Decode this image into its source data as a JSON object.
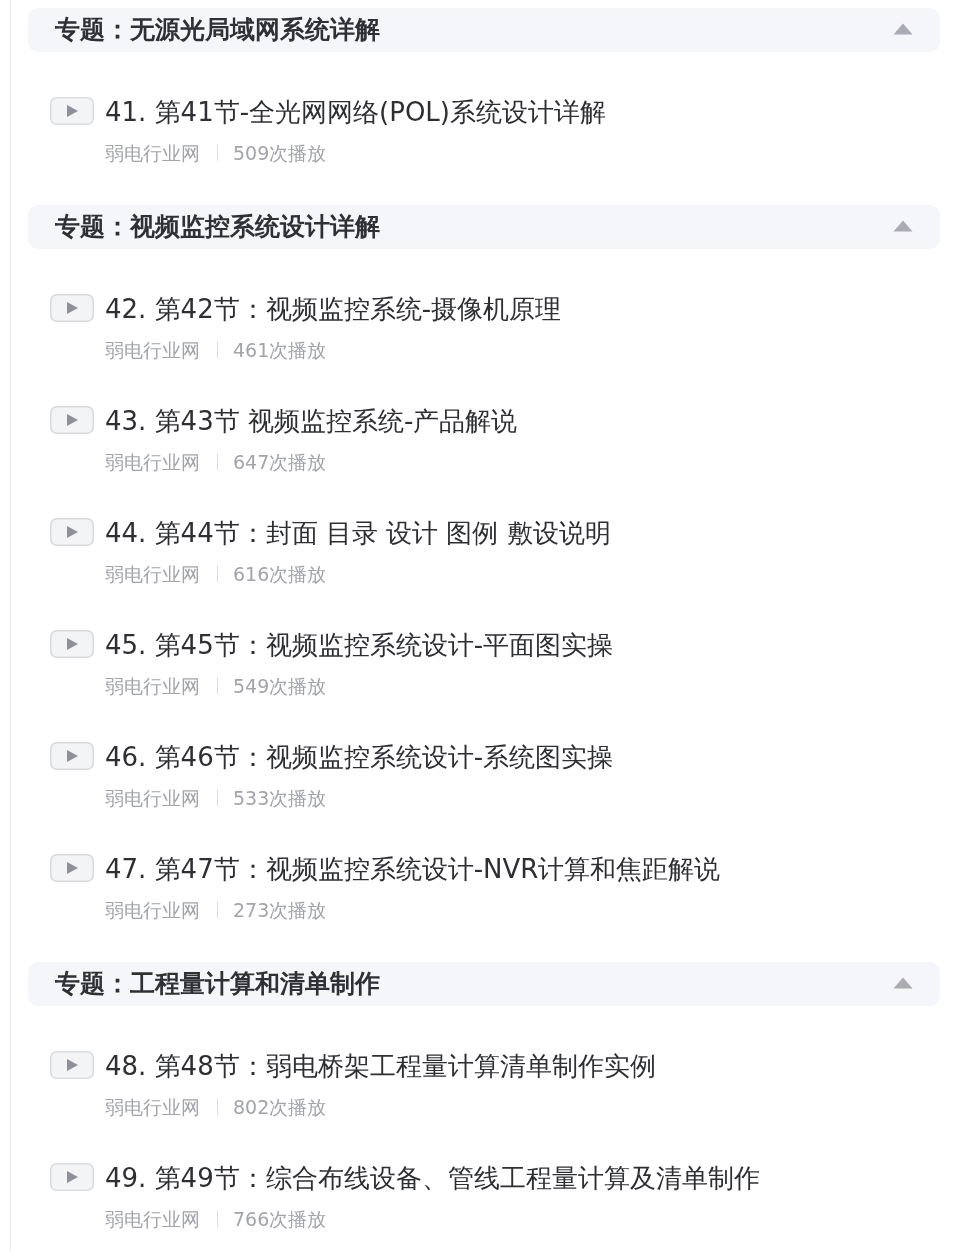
{
  "sections": [
    {
      "title": "专题：无源光局域网系统详解",
      "expanded": true,
      "items": [
        {
          "title": "41. 第41节-全光网网络(POL)系统设计详解",
          "source": "弱电行业网",
          "plays": "509次播放"
        }
      ]
    },
    {
      "title": "专题：视频监控系统设计详解",
      "expanded": true,
      "items": [
        {
          "title": "42. 第42节：视频监控系统-摄像机原理",
          "source": "弱电行业网",
          "plays": "461次播放"
        },
        {
          "title": "43. 第43节 视频监控系统-产品解说",
          "source": "弱电行业网",
          "plays": "647次播放"
        },
        {
          "title": "44. 第44节：封面 目录 设计 图例 敷设说明",
          "source": "弱电行业网",
          "plays": "616次播放"
        },
        {
          "title": "45. 第45节：视频监控系统设计-平面图实操",
          "source": "弱电行业网",
          "plays": "549次播放"
        },
        {
          "title": "46. 第46节：视频监控系统设计-系统图实操",
          "source": "弱电行业网",
          "plays": "533次播放"
        },
        {
          "title": "47. 第47节：视频监控系统设计-NVR计算和焦距解说",
          "source": "弱电行业网",
          "plays": "273次播放"
        }
      ]
    },
    {
      "title": "专题：工程量计算和清单制作",
      "expanded": true,
      "items": [
        {
          "title": "48. 第48节：弱电桥架工程量计算清单制作实例",
          "source": "弱电行业网",
          "plays": "802次播放"
        },
        {
          "title": "49. 第49节：综合布线设备、管线工程量计算及清单制作",
          "source": "弱电行业网",
          "plays": "766次播放"
        }
      ]
    }
  ]
}
